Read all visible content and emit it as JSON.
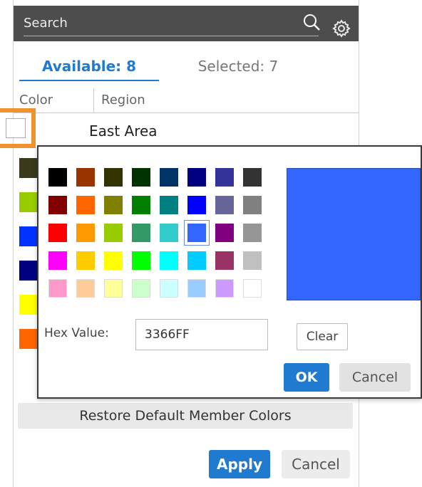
{
  "search": {
    "placeholder": "Search"
  },
  "icons": {
    "search": "search-icon",
    "settings": "gear-icon"
  },
  "tabs": [
    {
      "label": "Available: 8",
      "active": true
    },
    {
      "label": "Selected: 7",
      "active": false
    }
  ],
  "columns": {
    "color": "Color",
    "region": "Region"
  },
  "rows": [
    {
      "region": "East Area",
      "color": "#ffffff"
    }
  ],
  "member_swatches": [
    "#3a3a1a",
    "#99cc00",
    "#0033ff",
    "#000080",
    "#ffff00",
    "#ff6600"
  ],
  "restore_button": "Restore Default Member Colors",
  "apply_button": "Apply",
  "cancel_button": "Cancel",
  "color_picker": {
    "palette": [
      [
        "#000000",
        "#993300",
        "#333300",
        "#003300",
        "#003366",
        "#000080",
        "#333399",
        "#333333"
      ],
      [
        "#800000",
        "#ff6600",
        "#808000",
        "#008000",
        "#008080",
        "#0000ff",
        "#666699",
        "#808080"
      ],
      [
        "#ff0000",
        "#ff9900",
        "#99cc00",
        "#339966",
        "#33cccc",
        "#3366ff",
        "#800080",
        "#969696"
      ],
      [
        "#ff00ff",
        "#ffcc00",
        "#ffff00",
        "#00ff00",
        "#00ffff",
        "#00ccff",
        "#993366",
        "#c0c0c0"
      ],
      [
        "#ff99cc",
        "#ffcc99",
        "#ffff99",
        "#ccffcc",
        "#ccffff",
        "#99ccff",
        "#cc99ff",
        "#ffffff"
      ]
    ],
    "selected_color": "#3366ff",
    "hex_label": "Hex Value:",
    "hex_value": "3366FF",
    "clear_button": "Clear",
    "ok_button": "OK",
    "cancel_button": "Cancel"
  }
}
